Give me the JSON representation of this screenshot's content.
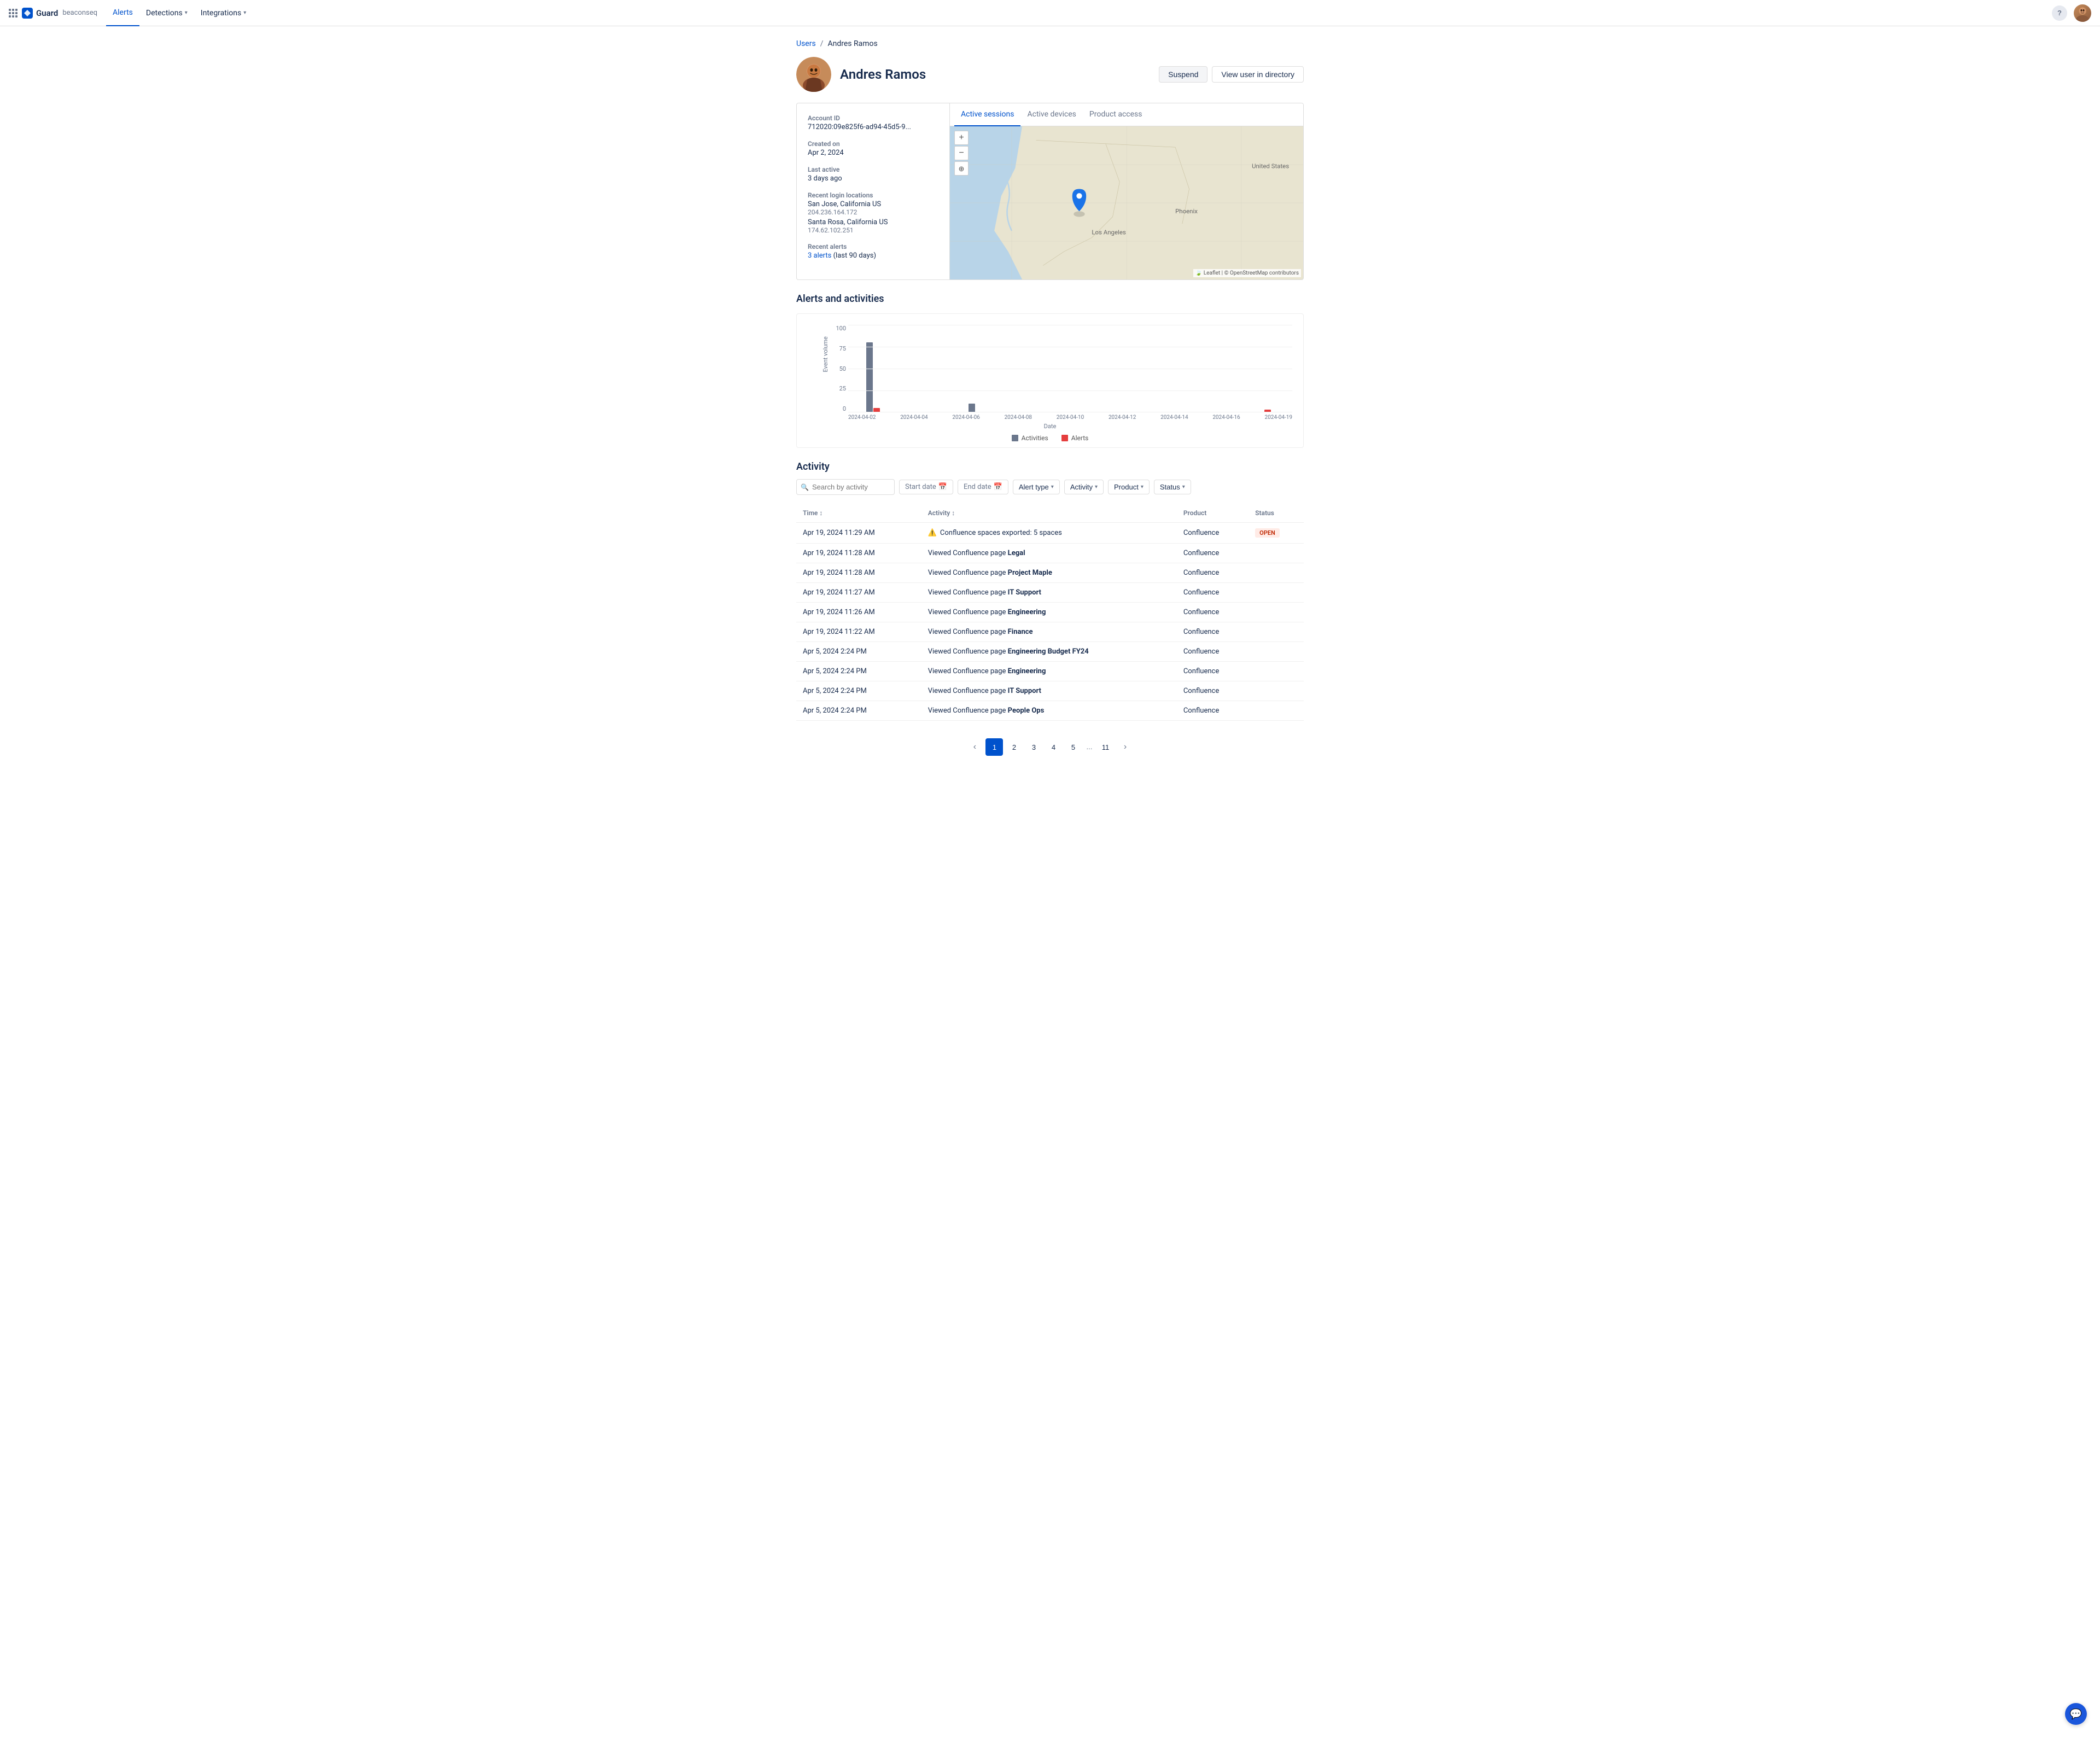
{
  "app": {
    "name": "Guard",
    "tenant": "beaconseq"
  },
  "nav": {
    "links": [
      {
        "id": "alerts",
        "label": "Alerts",
        "active": true
      },
      {
        "id": "detections",
        "label": "Detections",
        "dropdown": true
      },
      {
        "id": "integrations",
        "label": "Integrations",
        "dropdown": true
      }
    ]
  },
  "breadcrumb": {
    "parent": "Users",
    "current": "Andres Ramos"
  },
  "user": {
    "name": "Andres Ramos",
    "account_id": "712020:09e825f6-ad94-45d5-9...",
    "created_on": "Apr 2, 2024",
    "last_active": "3 days ago",
    "recent_login_locations": [
      {
        "city": "San Jose, California US",
        "ip": "204.236.164.172"
      },
      {
        "city": "Santa Rosa, California US",
        "ip": "174.62.102.251"
      }
    ],
    "recent_alerts_count": "3 alerts",
    "recent_alerts_period": "(last 90 days)"
  },
  "actions": {
    "suspend": "Suspend",
    "view_directory": "View user in directory"
  },
  "tabs": {
    "active_sessions": "Active sessions",
    "active_devices": "Active devices",
    "product_access": "Product access"
  },
  "chart": {
    "title": "Alerts and activities",
    "y_axis_label": "Event volume",
    "y_labels": [
      "100",
      "75",
      "50",
      "25",
      "0"
    ],
    "x_labels": [
      "2024-04-02",
      "2024-04-04",
      "2024-04-06",
      "2024-04-08",
      "2024-04-10",
      "2024-04-12",
      "2024-04-14",
      "2024-04-16",
      "2024-04-19"
    ],
    "date_label": "Date",
    "legend": [
      {
        "label": "Activities",
        "color": "#6b778c"
      },
      {
        "label": "Alerts",
        "color": "#e53e3e"
      }
    ],
    "bars": [
      {
        "date": "2024-04-02",
        "activities": 80,
        "alerts": 5
      },
      {
        "date": "2024-04-04",
        "activities": 0,
        "alerts": 0
      },
      {
        "date": "2024-04-06",
        "activities": 10,
        "alerts": 0
      },
      {
        "date": "2024-04-08",
        "activities": 0,
        "alerts": 0
      },
      {
        "date": "2024-04-10",
        "activities": 0,
        "alerts": 0
      },
      {
        "date": "2024-04-12",
        "activities": 0,
        "alerts": 0
      },
      {
        "date": "2024-04-14",
        "activities": 0,
        "alerts": 0
      },
      {
        "date": "2024-04-16",
        "activities": 0,
        "alerts": 0
      },
      {
        "date": "2024-04-19",
        "activities": 0,
        "alerts": 3
      }
    ]
  },
  "activity": {
    "section_title": "Activity",
    "search_placeholder": "Search by activity",
    "filters": {
      "start_date": "Start date",
      "end_date": "End date",
      "alert_type": "Alert type",
      "activity": "Activity",
      "product": "Product",
      "status": "Status"
    },
    "columns": {
      "time": "Time ↕",
      "activity": "Activity ↕",
      "product": "Product",
      "status": "Status"
    },
    "rows": [
      {
        "time": "Apr 19, 2024 11:29 AM",
        "activity": "Confluence spaces exported: 5 spaces",
        "product": "Confluence",
        "status": "OPEN",
        "is_alert": true
      },
      {
        "time": "Apr 19, 2024 11:28 AM",
        "activity_prefix": "Viewed Confluence page ",
        "activity_bold": "Legal",
        "product": "Confluence",
        "status": ""
      },
      {
        "time": "Apr 19, 2024 11:28 AM",
        "activity_prefix": "Viewed Confluence page ",
        "activity_bold": "Project Maple",
        "product": "Confluence",
        "status": ""
      },
      {
        "time": "Apr 19, 2024 11:27 AM",
        "activity_prefix": "Viewed Confluence page ",
        "activity_bold": "IT Support",
        "product": "Confluence",
        "status": ""
      },
      {
        "time": "Apr 19, 2024 11:26 AM",
        "activity_prefix": "Viewed Confluence page ",
        "activity_bold": "Engineering",
        "product": "Confluence",
        "status": ""
      },
      {
        "time": "Apr 19, 2024 11:22 AM",
        "activity_prefix": "Viewed Confluence page ",
        "activity_bold": "Finance",
        "product": "Confluence",
        "status": ""
      },
      {
        "time": "Apr 5, 2024 2:24 PM",
        "activity_prefix": "Viewed Confluence page ",
        "activity_bold": "Engineering Budget FY24",
        "product": "Confluence",
        "status": ""
      },
      {
        "time": "Apr 5, 2024 2:24 PM",
        "activity_prefix": "Viewed Confluence page ",
        "activity_bold": "Engineering",
        "product": "Confluence",
        "status": ""
      },
      {
        "time": "Apr 5, 2024 2:24 PM",
        "activity_prefix": "Viewed Confluence page ",
        "activity_bold": "IT Support",
        "product": "Confluence",
        "status": ""
      },
      {
        "time": "Apr 5, 2024 2:24 PM",
        "activity_prefix": "Viewed Confluence page ",
        "activity_bold": "People Ops",
        "product": "Confluence",
        "status": ""
      }
    ]
  },
  "pagination": {
    "current": 1,
    "pages": [
      "1",
      "2",
      "3",
      "4",
      "5",
      "...",
      "11"
    ]
  }
}
